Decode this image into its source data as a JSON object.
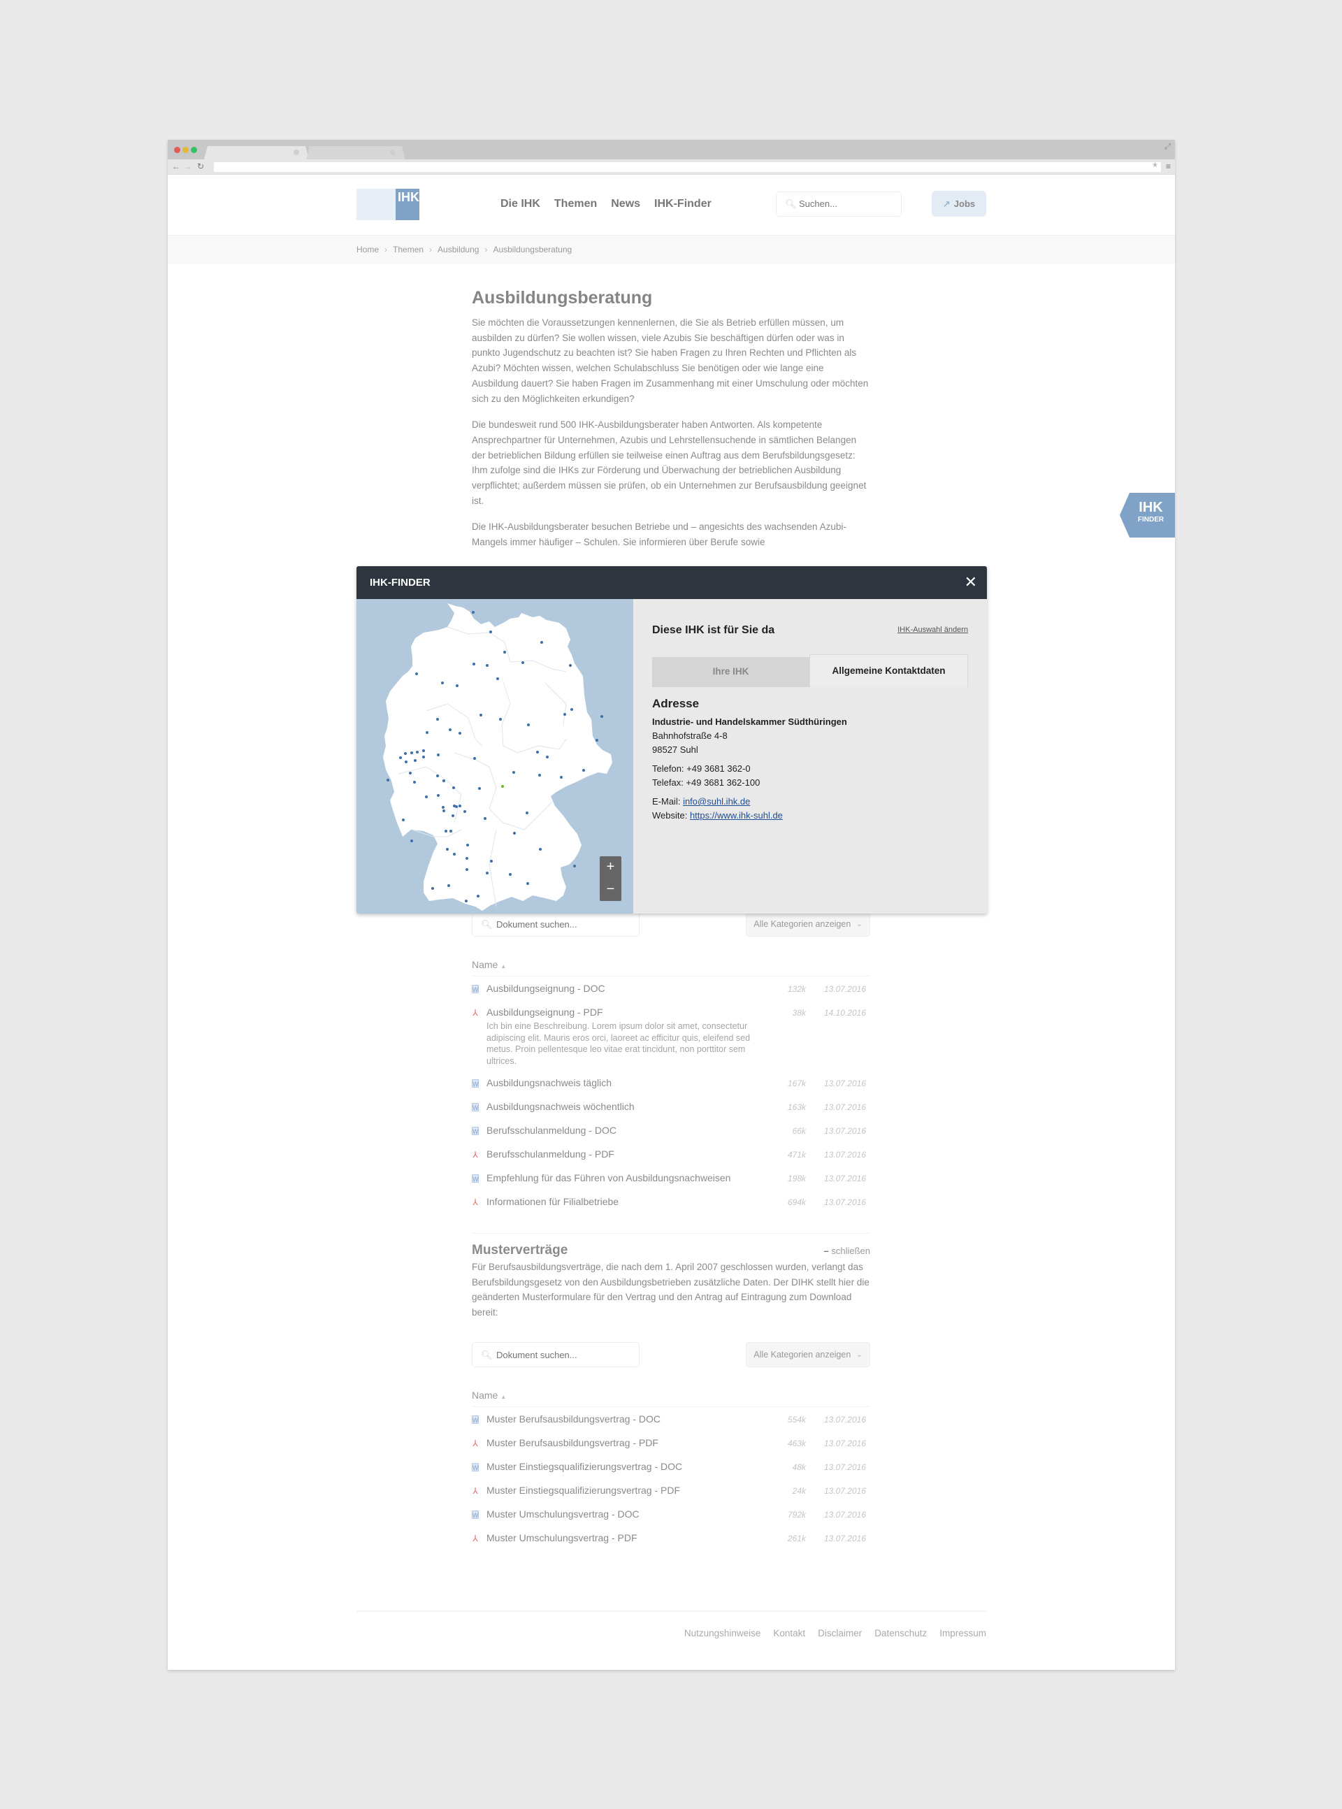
{
  "browser": {
    "tabs": [
      "",
      ""
    ],
    "url": ""
  },
  "header": {
    "logo_text": "IHK",
    "nav": [
      "Die IHK",
      "Themen",
      "News",
      "IHK-Finder"
    ],
    "search_placeholder": "Suchen...",
    "jobs_label": "Jobs"
  },
  "breadcrumb": [
    "Home",
    "Themen",
    "Ausbildung",
    "Ausbildungsberatung"
  ],
  "main": {
    "title": "Ausbildungsberatung",
    "paragraphs": [
      "Sie möchten die Voraussetzungen kennenlernen, die Sie als Betrieb erfüllen müssen, um ausbilden zu dürfen? Sie wollen wissen, viele Azubis Sie beschäftigen dürfen oder was in punkto Jugendschutz zu beachten ist? Sie haben Fragen zu Ihren Rechten und Pflichten als Azubi? Möchten wissen, welchen Schulabschluss Sie benötigen oder wie lange eine Ausbildung dauert? Sie haben Fragen im Zusammenhang mit einer Umschulung oder möchten sich zu den Möglichkeiten erkundigen?",
      "Die bundesweit rund 500 IHK-Ausbildungsberater haben Antworten. Als kompetente Ansprechpartner für Unternehmen, Azubis und Lehrstellensuchende in sämtlichen Belangen der betrieblichen Bildung erfüllen sie teilweise einen Auftrag aus dem Berufsbildungsgesetz: Ihm zufolge sind die IHKs zur Förderung und Überwachung der betrieblichen Ausbildung verpflichtet; außerdem müssen sie prüfen, ob ein Unternehmen zur Berufsausbildung geeignet ist.",
      "Die IHK-Ausbildungsberater besuchen Betriebe und – angesichts des wachsenden Azubi-Mangels immer häufiger – Schulen. Sie informieren über Berufe sowie"
    ]
  },
  "finder_tab": {
    "big": "IHK",
    "small": "FINDER"
  },
  "modal": {
    "title": "IHK-FINDER",
    "panel_title": "Diese IHK ist für Sie da",
    "change_link": "IHK-Auswahl ändern",
    "tabs": [
      "Ihre IHK",
      "Allgemeine Kontaktdaten"
    ],
    "active_tab": "Allgemeine Kontaktdaten",
    "address_heading": "Adresse",
    "org": "Industrie- und Handelskammer Südthüringen",
    "street": "Bahnhofstraße 4-8",
    "city": "98527 Suhl",
    "phone": "Telefon: +49 3681 362-0",
    "fax": "Telefax: +49 3681 362-100",
    "email_label": "E-Mail: ",
    "email": "info@suhl.ihk.de",
    "website_label": "Website: ",
    "website": "https://www.ihk-suhl.de",
    "zoom_in": "+",
    "zoom_out": "−",
    "colors": {
      "marker": "#3f6fa8",
      "selected_marker": "#6ab82a",
      "water": "#b1c8dd"
    }
  },
  "docs1": {
    "search_placeholder": "Dokument suchen...",
    "filter": "Alle Kategorien anzeigen",
    "name_header": "Name",
    "rows": [
      {
        "type": "doc",
        "title": "Ausbildungseignung - DOC",
        "size": "132k",
        "date": "13.07.2016"
      },
      {
        "type": "pdf",
        "title": "Ausbildungseignung - PDF",
        "size": "38k",
        "date": "14.10.2016",
        "desc": "Ich bin eine Beschreibung. Lorem ipsum dolor sit amet, consectetur adipiscing elit. Mauris eros orci, laoreet ac efficitur quis, eleifend sed metus. Proin pellentesque leo vitae erat tincidunt, non porttitor sem ultrices."
      },
      {
        "type": "doc",
        "title": "Ausbildungsnachweis täglich",
        "size": "167k",
        "date": "13.07.2016"
      },
      {
        "type": "doc",
        "title": "Ausbildungsnachweis wöchentlich",
        "size": "163k",
        "date": "13.07.2016"
      },
      {
        "type": "doc",
        "title": "Berufsschulanmeldung - DOC",
        "size": "66k",
        "date": "13.07.2016"
      },
      {
        "type": "pdf",
        "title": "Berufsschulanmeldung - PDF",
        "size": "471k",
        "date": "13.07.2016"
      },
      {
        "type": "doc",
        "title": "Empfehlung für das Führen von Ausbildungsnachweisen",
        "size": "198k",
        "date": "13.07.2016"
      },
      {
        "type": "pdf",
        "title": "Informationen für Filialbetriebe",
        "size": "694k",
        "date": "13.07.2016"
      }
    ]
  },
  "section2": {
    "title": "Musterverträge",
    "close_label": "schließen",
    "text": "Für Berufsausbildungsverträge, die nach dem 1. April 2007 geschlossen wurden, verlangt das Berufsbildungsgesetz von den Ausbildungsbetrieben zusätzliche Daten. Der DIHK stellt hier die geänderten Musterformulare für den Vertrag und den Antrag auf Eintragung zum Download bereit:"
  },
  "docs2": {
    "search_placeholder": "Dokument suchen...",
    "filter": "Alle Kategorien anzeigen",
    "name_header": "Name",
    "rows": [
      {
        "type": "doc",
        "title": "Muster Berufsausbildungsvertrag - DOC",
        "size": "554k",
        "date": "13.07.2016"
      },
      {
        "type": "pdf",
        "title": "Muster Berufsausbildungsvertrag - PDF",
        "size": "463k",
        "date": "13.07.2016"
      },
      {
        "type": "doc",
        "title": "Muster Einstiegsqualifizierungsvertrag - DOC",
        "size": "48k",
        "date": "13.07.2016"
      },
      {
        "type": "pdf",
        "title": "Muster Einstiegsqualifizierungsvertrag - PDF",
        "size": "24k",
        "date": "13.07.2016"
      },
      {
        "type": "doc",
        "title": "Muster Umschulungsvertrag - DOC",
        "size": "792k",
        "date": "13.07.2016"
      },
      {
        "type": "pdf",
        "title": "Muster Umschulungsvertrag - PDF",
        "size": "261k",
        "date": "13.07.2016"
      }
    ]
  },
  "footer": [
    "Nutzungshinweise",
    "Kontakt",
    "Disclaimer",
    "Datenschutz",
    "Impressum"
  ]
}
